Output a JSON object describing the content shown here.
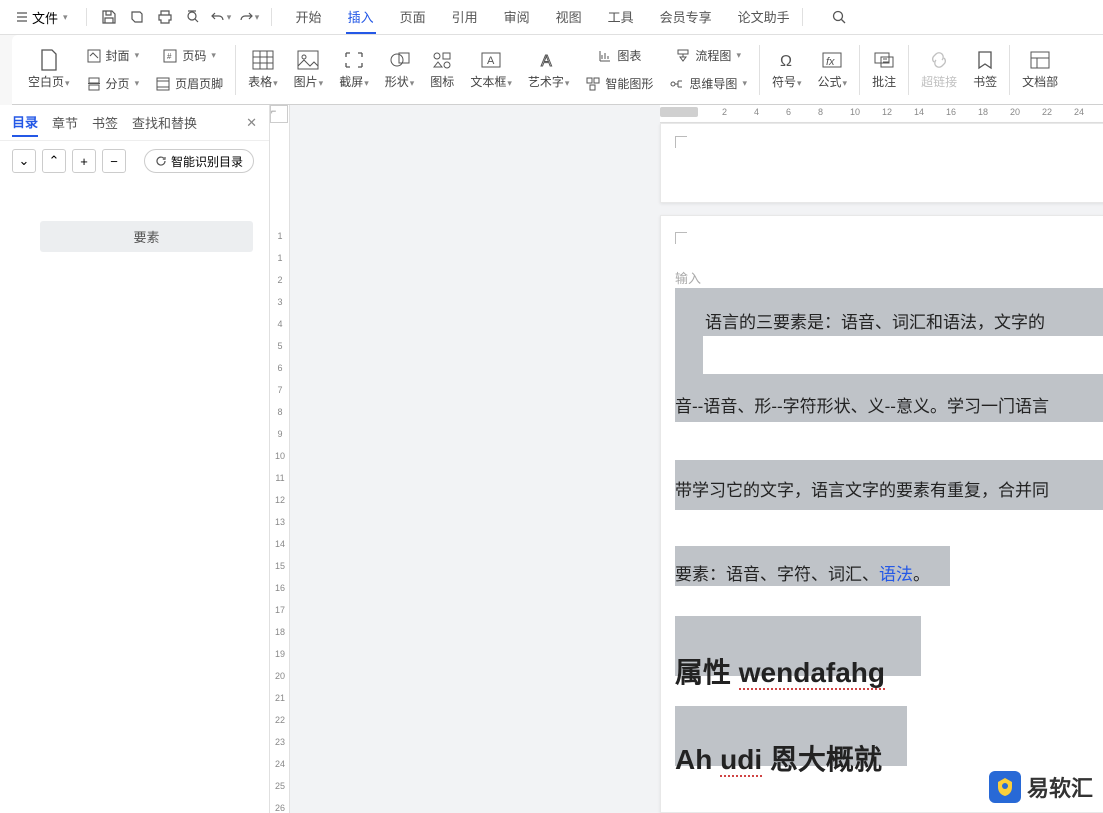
{
  "menubar": {
    "file_label": "文件",
    "tabs": [
      "开始",
      "插入",
      "页面",
      "引用",
      "审阅",
      "视图",
      "工具",
      "会员专享",
      "论文助手"
    ],
    "active_tab_index": 1
  },
  "ribbon": {
    "group_page": {
      "blank": "空白页",
      "cover": "封面",
      "pageno": "页码",
      "break": "分页",
      "headerfooter": "页眉页脚"
    },
    "group_insert": {
      "table": "表格",
      "picture": "图片",
      "screenshot": "截屏",
      "shape": "形状",
      "icon": "图标",
      "textbox": "文本框",
      "wordart": "艺术字",
      "chart": "图表",
      "smartart": "智能图形",
      "flowchart": "流程图",
      "mindmap": "思维导图"
    },
    "group_misc": {
      "symbol": "符号",
      "equation": "公式",
      "comment": "批注",
      "hyperlink": "超链接",
      "bookmark": "书签",
      "docpart": "文档部"
    }
  },
  "left_panel": {
    "tabs": [
      "目录",
      "章节",
      "书签",
      "查找和替换"
    ],
    "active_index": 0,
    "smart_btn": "智能识别目录",
    "items": [
      "要素"
    ]
  },
  "hruler_values": [
    "2",
    "4",
    "6",
    "8",
    "10",
    "12",
    "14",
    "16",
    "18",
    "20",
    "22",
    "24"
  ],
  "vruler_values": [
    "1",
    "1",
    "2",
    "3",
    "4",
    "5",
    "6",
    "7",
    "8",
    "9",
    "10",
    "11",
    "12",
    "13",
    "14",
    "15",
    "16",
    "17",
    "18",
    "19",
    "20",
    "21",
    "22",
    "23",
    "24",
    "25",
    "26"
  ],
  "doc": {
    "input_placeholder": "输入",
    "line1": "语言的三要素是：语音、词汇和语法，文字的",
    "line2": "音--语音、形--字符形状、义--意义。学习一门语言",
    "line3": "带学习它的文字，语言文字的要素有重复，合并同",
    "line4_a": "要素：语音、字符、词汇、",
    "line4_link": "语法",
    "line4_b": "。",
    "bold1_a": "属性 ",
    "bold1_b": "wendafahg",
    "bold2_a": "Ah ",
    "bold2_b": "udi",
    "bold2_c": " 恩大概就"
  },
  "watermark": "易软汇"
}
